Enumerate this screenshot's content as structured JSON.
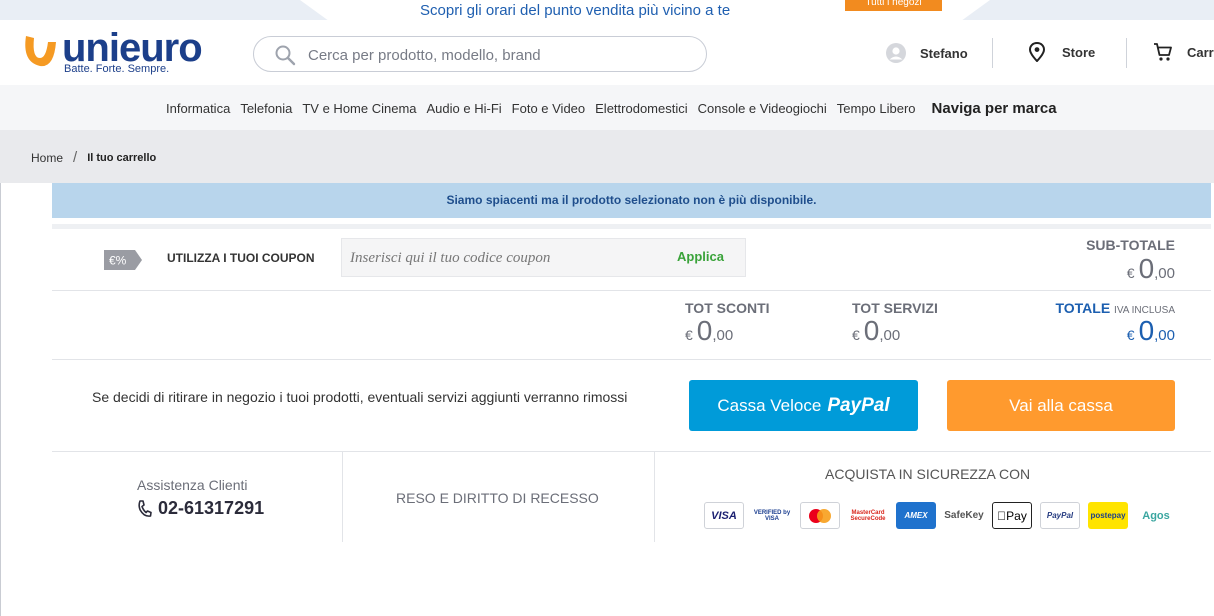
{
  "promo": {
    "text": "Scopri gli orari del punto vendita più vicino a te",
    "button": "Tutti i negozi"
  },
  "header": {
    "logo_word": "unieuro",
    "logo_tag": "Batte. Forte. Sempre.",
    "search_placeholder": "Cerca per prodotto, modello, brand",
    "user": "Stefano",
    "store": "Store",
    "cart": "Carrello"
  },
  "categories": [
    "Informatica",
    "Telefonia",
    "TV e Home Cinema",
    "Audio e Hi-Fi",
    "Foto e Video",
    "Elettrodomestici",
    "Console e Videogiochi",
    "Tempo Libero"
  ],
  "brand_nav": "Naviga per marca",
  "breadcrumb": {
    "home": "Home",
    "separator": "/",
    "current": "Il tuo carrello"
  },
  "alert": "Siamo spiacenti ma il prodotto selezionato non è più disponibile.",
  "coupon": {
    "tag": "€%",
    "label": "UTILIZZA I TUOI COUPON",
    "placeholder": "Inserisci qui il tuo codice coupon",
    "apply": "Applica"
  },
  "currency": "€",
  "subtotal": {
    "label": "SUB-TOTALE",
    "int": "0",
    "dec": ",00"
  },
  "totals": {
    "discounts": {
      "label": "TOT SCONTI",
      "int": "0",
      "dec": ",00"
    },
    "services": {
      "label": "TOT SERVIZI",
      "int": "0",
      "dec": ",00"
    },
    "total": {
      "label": "TOTALE",
      "note": "IVA INCLUSA",
      "int": "0",
      "dec": ",00"
    }
  },
  "checkout": {
    "notice": "Se decidi di ritirare in negozio i tuoi prodotti, eventuali servizi aggiunti verranno rimossi",
    "paypal_prefix": "Cassa Veloce",
    "paypal_brand": "PayPal",
    "checkout_label": "Vai alla cassa"
  },
  "footer": {
    "assist_label": "Assistenza Clienti",
    "phone": "02-61317291",
    "returns": "RESO E DIRITTO DI RECESSO",
    "secure": "ACQUISTA IN SICUREZZA CON"
  },
  "payment_methods": {
    "visa": "VISA",
    "verified": "VERIFIED by VISA",
    "mastercard": "mastercard",
    "securecode": "MasterCard SecureCode",
    "amex": "AMEX",
    "safekey": "SafeKey",
    "applepay": "Pay",
    "paypal": "PayPal",
    "postepay": "postepay",
    "agos": "Agos"
  },
  "colors": {
    "brand_blue": "#1c3f8a",
    "brand_orange": "#f59a23",
    "paypal_blue": "#009bd9",
    "checkout_orange": "#ff9a2e",
    "alert_bg": "#b8d5ec",
    "total_blue": "#1c5fb0"
  }
}
